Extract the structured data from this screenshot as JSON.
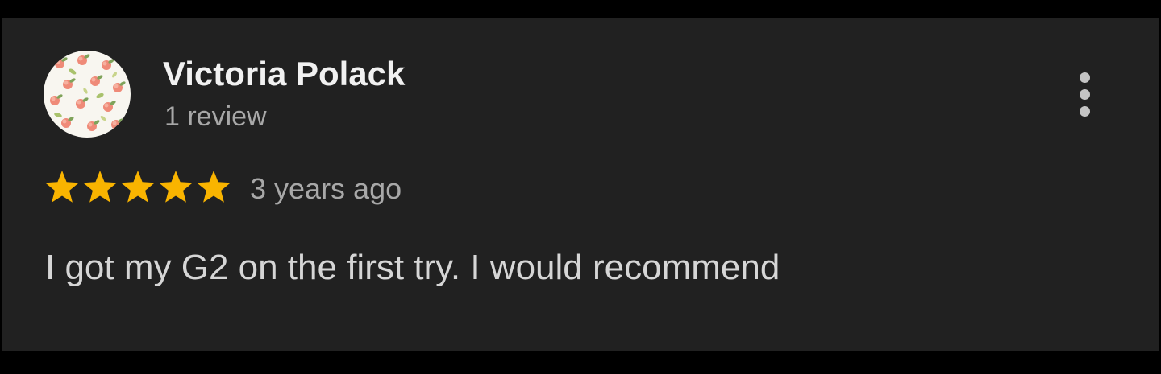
{
  "review": {
    "author_name": "Victoria Polack",
    "author_review_count": "1 review",
    "avatar_icon": "peach-pattern-avatar",
    "rating": 5,
    "rating_max": 5,
    "star_color": "#F9B400",
    "timestamp": "3 years ago",
    "text": "I got my G2 on the first try. I would recommend",
    "menu_icon": "more-vertical-icon"
  },
  "colors": {
    "card_background": "#212121",
    "outer_background": "#000000",
    "name_text": "#F1F1F1",
    "secondary_text": "#A8A8A8",
    "body_text": "#D6D6D6"
  }
}
